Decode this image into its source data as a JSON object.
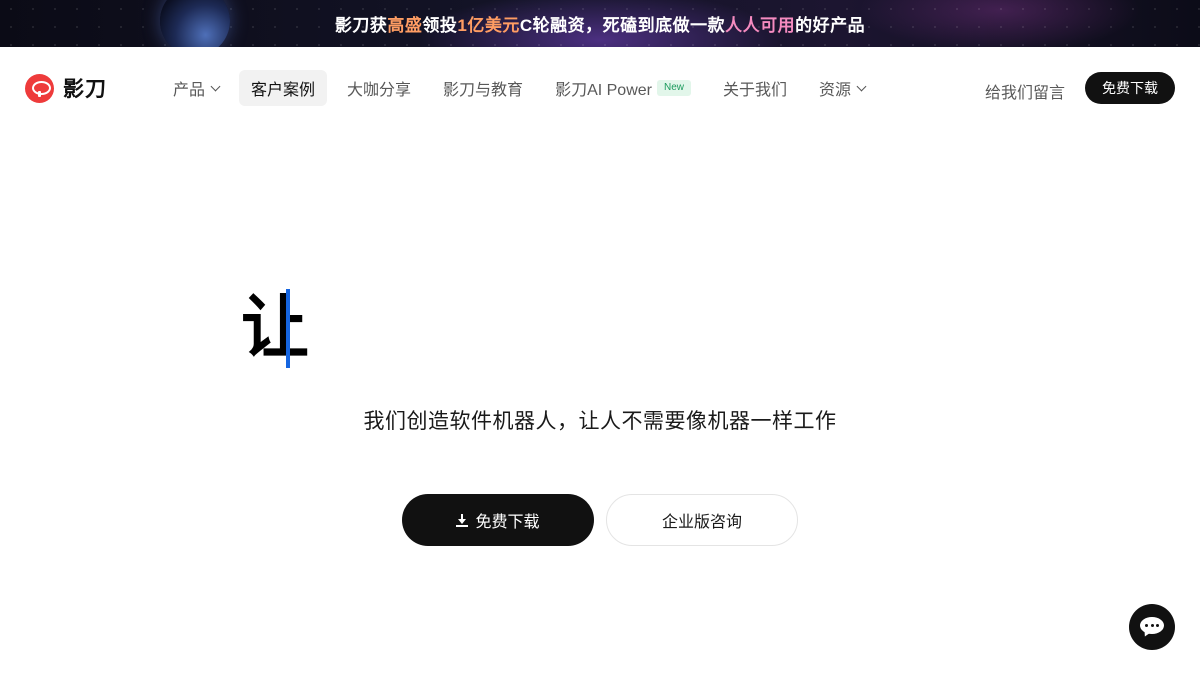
{
  "banner": {
    "part1": "影刀获",
    "highlight1": "高盛",
    "part2": "领投",
    "highlight2": "1亿美元",
    "part3": "C轮融资，死磕到底做一款",
    "highlight3": "人人可用",
    "part4": "的好产品"
  },
  "brand": {
    "name": "影刀",
    "logo_icon": "yingdao-logo-icon",
    "accent_color": "#ee3b3b"
  },
  "nav": {
    "items": [
      {
        "label": "产品",
        "has_dropdown": true,
        "active": false
      },
      {
        "label": "客户案例",
        "has_dropdown": false,
        "active": true
      },
      {
        "label": "大咖分享",
        "has_dropdown": false,
        "active": false
      },
      {
        "label": "影刀与教育",
        "has_dropdown": false,
        "active": false
      },
      {
        "label": "影刀AI Power",
        "badge": "New",
        "has_dropdown": false,
        "active": false
      },
      {
        "label": "关于我们",
        "has_dropdown": false,
        "active": false
      },
      {
        "label": "资源",
        "has_dropdown": true,
        "active": false
      }
    ],
    "feedback": "给我们留言",
    "download": "免费下载"
  },
  "hero": {
    "typed_text": "让",
    "subtitle": "我们创造软件机器人，让人不需要像机器一样工作",
    "primary_cta": "免费下载",
    "secondary_cta": "企业版咨询",
    "cursor_color": "#1565e0"
  },
  "chat": {
    "icon": "chat-bubble-icon"
  }
}
